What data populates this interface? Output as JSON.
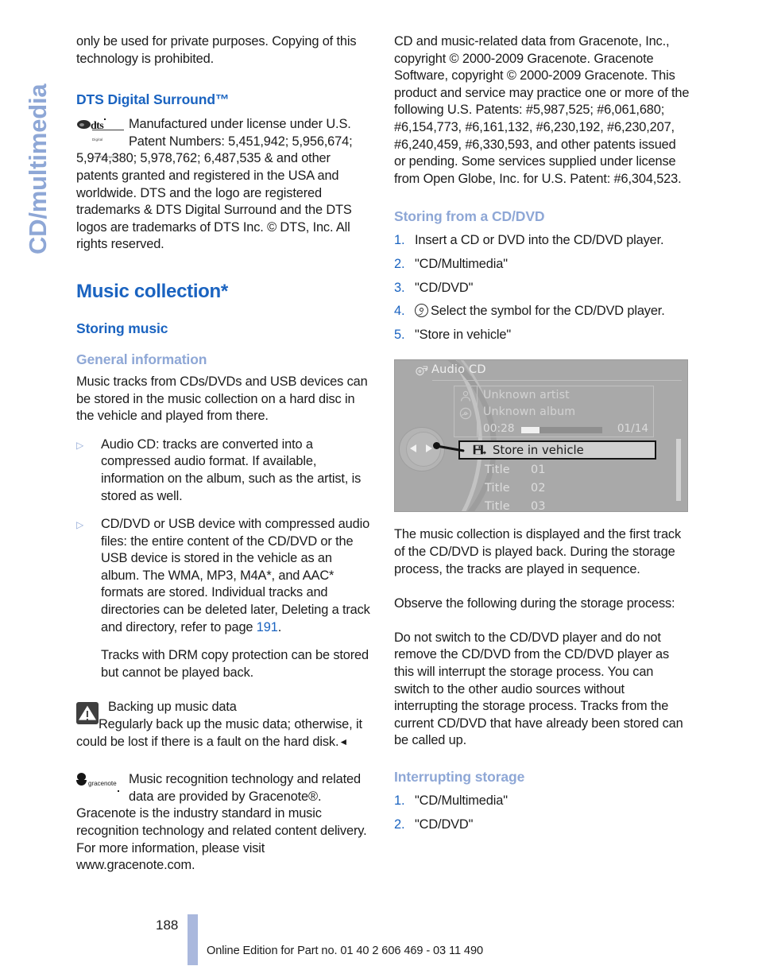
{
  "side_tab": {
    "label": "CD/multimedia"
  },
  "left_column": {
    "intro_paragraph": "only be used for private purposes. Copying of this technology is prohibited.",
    "dts_heading": "DTS Digital Surround™",
    "dts_logo": {
      "word": "dts",
      "tagline": "Digital Entertainment"
    },
    "dts_paragraph": "Manufactured under license under U.S. Patent Numbers: 5,451,942; 5,956,674; 5,974,380; 5,978,762; 6,487,535 & and other patents granted and registered in the USA and worldwide. DTS and the logo are registered trademarks & DTS Digital Surround and the DTS logos are trademarks of DTS Inc. © DTS, Inc. All rights reserved.",
    "section_title": "Music collection*",
    "subsection_title": "Storing music",
    "general_info_title": "General information",
    "general_info_paragraph": "Music tracks from CDs/DVDs and USB devices can be stored in the music collection on a hard disc in the vehicle and played from there.",
    "bullets": [
      {
        "marker": "▷",
        "text": "Audio CD: tracks are converted into a compressed audio format. If available, information on the album, such as the artist, is stored as well."
      },
      {
        "marker": "▷",
        "text_before_link": "CD/DVD or USB device with compressed audio files: the entire content of the CD/DVD or the USB device is stored in the vehicle as an album. The WMA, MP3, M4A*, and AAC* formats are stored. Individual tracks and directories can be deleted later, Deleting a track and directory, refer to page ",
        "link": "191",
        "text_after_link": "."
      }
    ],
    "bullet_continuation": "Tracks with DRM copy protection can be stored but cannot be played back.",
    "warning": {
      "icon": "warning-triangle-icon",
      "title": "Backing up music data",
      "body": "Regularly back up the music data; otherwise, it could be lost if there is a fault on the hard disk.",
      "end_mark": "◄"
    },
    "gracenote_logo": {
      "word": "gracenote"
    },
    "gracenote_paragraph": "Music recognition technology and related data are provided by Gracenote®. Gracenote is the industry standard in music recognition technology and related content delivery. For more information, please visit www.gracenote.com."
  },
  "right_column": {
    "gracenote_legal": "CD and music-related data from Gracenote, Inc., copyright © 2000-2009 Gracenote. Gracenote Software, copyright © 2000-2009 Gracenote. This product and service may practice one or more of the following U.S. Patents: #5,987,525; #6,061,680; #6,154,773, #6,161,132, #6,230,192, #6,230,207, #6,240,459, #6,330,593, and other patents issued or pending. Some services supplied under license from Open Globe, Inc. for U.S. Patent: #6,304,523.",
    "storing_heading": "Storing from a CD/DVD",
    "storing_steps": [
      {
        "number": "1.",
        "text": "Insert a CD or DVD into the CD/DVD player."
      },
      {
        "number": "2.",
        "text": "\"CD/Multimedia\""
      },
      {
        "number": "3.",
        "text": "\"CD/DVD\""
      },
      {
        "number": "4.",
        "icon": "cd-disc-icon",
        "text": "Select the symbol for the CD/DVD player."
      },
      {
        "number": "5.",
        "text": "\"Store in vehicle\""
      }
    ],
    "after_figure_paragraphs": [
      "The music collection is displayed and the first track of the CD/DVD is played back. During the storage process, the tracks are played in sequence.",
      "Observe the following during the storage process:",
      "Do not switch to the CD/DVD player and do not remove the CD/DVD from the CD/DVD player as this will interrupt the storage process. You can switch to the other audio sources without interrupting the storage process. Tracks from the current CD/DVD that have already been stored can be called up."
    ],
    "interrupting_heading": "Interrupting storage",
    "interrupting_steps": [
      {
        "number": "1.",
        "text": "\"CD/Multimedia\""
      },
      {
        "number": "2.",
        "text": "\"CD/DVD\""
      }
    ]
  },
  "idrive_figure": {
    "title": "Audio CD",
    "title_icon": "audio-cd-icon",
    "artist": "Unknown artist",
    "album": "Unknown album",
    "elapsed_time": "00:28",
    "track_counter": "01/14",
    "progress_percent": 23,
    "selected_item": "Store in vehicle",
    "selected_item_icon": "save-to-vehicle-icon",
    "track_list": [
      {
        "label": "Title",
        "number": "01"
      },
      {
        "label": "Title",
        "number": "02"
      },
      {
        "label": "Title",
        "number": "03"
      }
    ]
  },
  "footer": {
    "page_number": "188",
    "text": "Online Edition for Part no. 01 40 2 606 469 - 03 11 490"
  },
  "colors": {
    "heading_blue": "#1a63c0",
    "accent_light_blue": "#8ea7d6",
    "footer_bar": "#aab8dd",
    "text": "#1b1b1b"
  }
}
